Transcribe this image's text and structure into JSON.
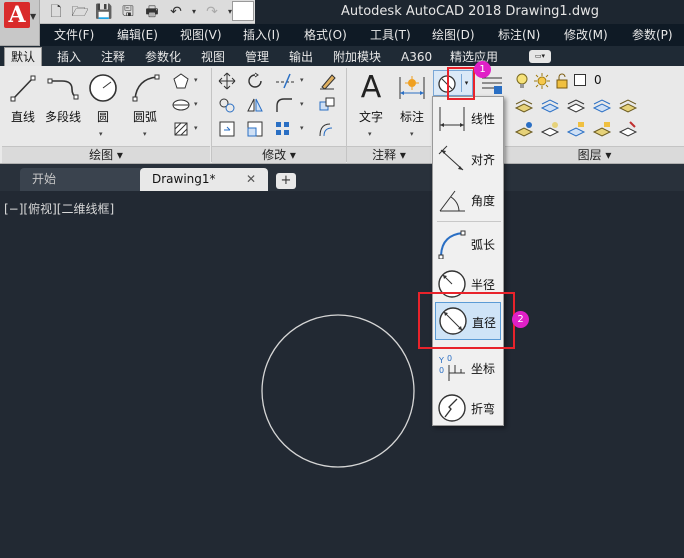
{
  "title": "Autodesk AutoCAD 2018    Drawing1.dwg",
  "app_logo": "A",
  "menu": [
    "文件(F)",
    "编辑(E)",
    "视图(V)",
    "插入(I)",
    "格式(O)",
    "工具(T)",
    "绘图(D)",
    "标注(N)",
    "修改(M)",
    "参数(P)"
  ],
  "ribbon_tabs": [
    "默认",
    "插入",
    "注释",
    "参数化",
    "视图",
    "管理",
    "输出",
    "附加模块",
    "A360",
    "精选应用"
  ],
  "draw_panel": {
    "title": "绘图",
    "tools": [
      "直线",
      "多段线",
      "圆",
      "圆弧"
    ]
  },
  "modify_panel": {
    "title": "修改"
  },
  "annotation_panel": {
    "title": "注释",
    "tools": [
      "文字",
      "标注"
    ]
  },
  "layer_panel": {
    "title": "图层",
    "current_layer": "0"
  },
  "dimension_menu": {
    "items": [
      "线性",
      "对齐",
      "角度",
      "弧长",
      "半径",
      "直径",
      "坐标",
      "折弯"
    ],
    "selected": "直径"
  },
  "callouts": [
    "1",
    "2"
  ],
  "file_tabs": {
    "start": "开始",
    "drawing": "Drawing1*",
    "close": "✕",
    "add": "+"
  },
  "viewport_label": "[−][俯视][二维线框]",
  "colors": {
    "canvas_bg": "#222933",
    "highlight_red": "#e8232b",
    "badge_magenta": "#e020c7",
    "selection_blue": "#cfe4f7"
  }
}
